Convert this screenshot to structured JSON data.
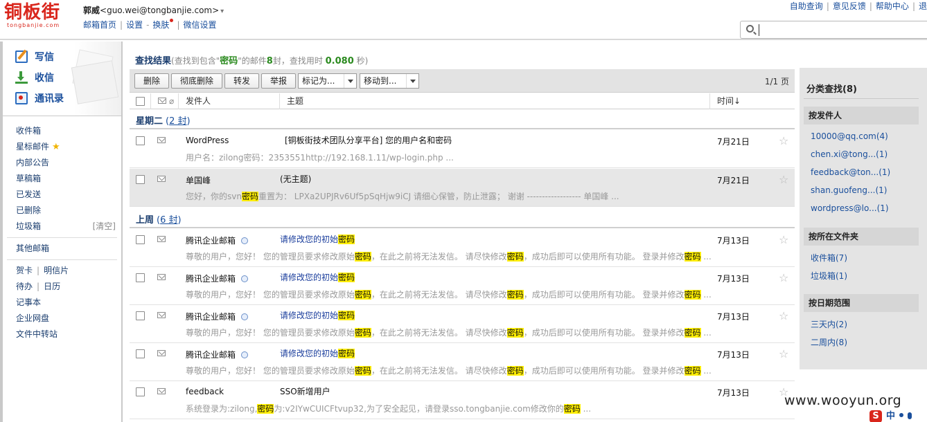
{
  "header": {
    "logo_text": "铜板街",
    "logo_subtext": "tongbanjie.com",
    "account_name": "郭威",
    "account_email": "<guo.wei@tongbanjie.com>",
    "account_caret": "▾",
    "nav": [
      "邮箱首页",
      "设置",
      "换肤",
      "微信设置"
    ],
    "right_links": [
      "自助查询",
      "意见反馈",
      "帮助中心",
      "退"
    ],
    "search_placeholder": ""
  },
  "sidebar": {
    "quick": [
      "写信",
      "收信",
      "通讯录"
    ],
    "folders": [
      {
        "label": "收件箱"
      },
      {
        "label": "星标邮件",
        "star": "★"
      },
      {
        "label": "内部公告"
      },
      {
        "label": "草稿箱"
      },
      {
        "label": "已发送"
      },
      {
        "label": "已删除"
      },
      {
        "label": "垃圾箱",
        "action": "[清空]"
      }
    ],
    "other": "其他邮箱",
    "tools": [
      [
        "贺卡",
        "明信片"
      ],
      [
        "待办",
        "日历"
      ],
      [
        "记事本"
      ],
      [
        "企业网盘"
      ],
      [
        "文件中转站"
      ]
    ]
  },
  "main": {
    "title": "查找结果",
    "sub_prefix": "(查找到包含\"",
    "keyword": "密码",
    "sub_mid": "\"的邮件",
    "count": "8",
    "sub_mid2": "封，查找用时 ",
    "time": "0.080",
    "sub_suffix": " 秒)",
    "toolbar": {
      "delete": "删除",
      "delete_forever": "彻底删除",
      "forward": "转发",
      "report": "举报",
      "mark_as": "标记为...",
      "move_to": "移动到...",
      "pager": "1/1 页"
    },
    "columns": {
      "sender": "发件人",
      "subject": "主题",
      "time": "时间↓"
    },
    "groups": [
      {
        "label": "星期二",
        "count": "2 封"
      },
      {
        "label": "上周",
        "count": "6 封"
      }
    ],
    "rows": [
      {
        "sender": "WordPress",
        "subject": "[铜板街技术团队分享平台] 您的用户名和密码",
        "date": "7月21日",
        "preview": [
          "用户名：zilong密码：2353551http://192.168.1.11/wp-login.php ..."
        ]
      },
      {
        "sender": "单国峰",
        "subject": "(无主题)",
        "date": "7月21日",
        "preview": [
          "您好，你的svn",
          "密码",
          "重置为： LPXa2UPJRv6Uf5pSqHjw9iCJ 请细心保管，防止泄露； 谢谢 ------------------ 单国峰 ..."
        ]
      },
      {
        "sender": "腾讯企业邮箱",
        "subject": [
          "请修改您的初始",
          "密码"
        ],
        "date": "7月13日",
        "preview": [
          "尊敬的用户，您好！ 您的管理员要求修改原始",
          "密码",
          "，在此之前将无法发信。 请尽快修改",
          "密码",
          "，成功后即可以使用所有功能。 登录并修改",
          "密码",
          " ..."
        ]
      },
      {
        "sender": "腾讯企业邮箱",
        "subject": [
          "请修改您的初始",
          "密码"
        ],
        "date": "7月13日",
        "preview": [
          "尊敬的用户，您好！ 您的管理员要求修改原始",
          "密码",
          "，在此之前将无法发信。 请尽快修改",
          "密码",
          "，成功后即可以使用所有功能。 登录并修改",
          "密码",
          " ..."
        ]
      },
      {
        "sender": "腾讯企业邮箱",
        "subject": [
          "请修改您的初始",
          "密码"
        ],
        "date": "7月13日",
        "preview": [
          "尊敬的用户，您好！ 您的管理员要求修改原始",
          "密码",
          "，在此之前将无法发信。 请尽快修改",
          "密码",
          "，成功后即可以使用所有功能。 登录并修改",
          "密码",
          " ..."
        ]
      },
      {
        "sender": "腾讯企业邮箱",
        "subject": [
          "请修改您的初始",
          "密码"
        ],
        "date": "7月13日",
        "preview": [
          "尊敬的用户，您好！ 您的管理员要求修改原始",
          "密码",
          "，在此之前将无法发信。 请尽快修改",
          "密码",
          "，成功后即可以使用所有功能。 登录并修改",
          "密码",
          " ..."
        ]
      },
      {
        "sender": "feedback",
        "subject": "SSO新增用户",
        "date": "7月13日",
        "preview": [
          "系统登录为:zilong,",
          "密码",
          "为:v2IYwCUICFtvup32,为了安全起见，请登录sso.tongbanjie.com修改你的",
          "密码",
          " ..."
        ]
      }
    ]
  },
  "category": {
    "title": "分类查找(8)",
    "by_sender_title": "按发件人",
    "by_sender": [
      "10000@qq.com(4)",
      "chen.xi@tong...(1)",
      "feedback@ton...(1)",
      "shan.guofeng...(1)",
      "wordpress@lo...(1)"
    ],
    "by_folder_title": "按所在文件夹",
    "by_folder": [
      "收件箱(7)",
      "垃圾箱(1)"
    ],
    "by_date_title": "按日期范围",
    "by_date": [
      "三天内(2)",
      "二周内(8)"
    ]
  },
  "watermark": "www.wooyun.org",
  "ime": {
    "logo": "S",
    "label": "中"
  },
  "star_glyph": "☆",
  "colors": {
    "highlight": "#ffee00",
    "accent_green": "#2b8a1f",
    "link_blue": "#1a4f9c",
    "brand_red": "#d9261c"
  }
}
